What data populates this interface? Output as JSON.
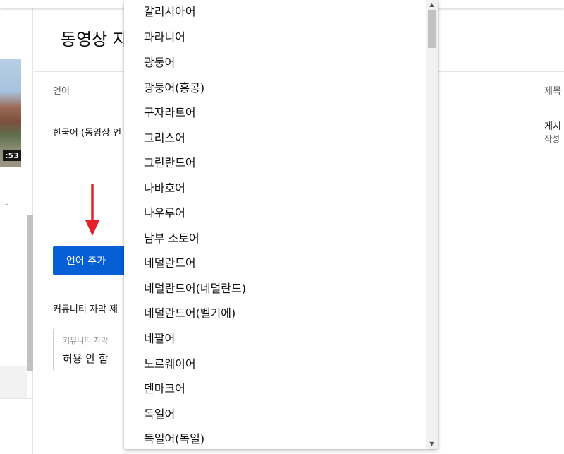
{
  "sidebar": {
    "thumbnail_duration": ":53",
    "dots": "..."
  },
  "dialog": {
    "title": "동영상 자",
    "columns": {
      "language": "언어",
      "title": "제목"
    },
    "row": {
      "language": "한국어 (동영상 언",
      "status": "게시",
      "meta": "작성"
    },
    "add_language_button": "언어 추가",
    "community_label": "커뮤니티 자막 제",
    "community_select": {
      "label": "커뮤니티 자막",
      "value": "허용 안 함"
    }
  },
  "colors": {
    "accent": "#065fd4",
    "arrow": "#e4202b"
  },
  "language_dropdown": {
    "items": [
      "갈리시아어",
      "과라니어",
      "광둥어",
      "광둥어(홍콩)",
      "구자라트어",
      "그리스어",
      "그린란드어",
      "나바호어",
      "나우루어",
      "남부 소토어",
      "네덜란드어",
      "네덜란드어(네덜란드)",
      "네덜란드어(벨기에)",
      "네팔어",
      "노르웨이어",
      "덴마크어",
      "독일어",
      "독일어(독일)"
    ],
    "scroll_up": "▲",
    "scroll_down": "▼"
  }
}
